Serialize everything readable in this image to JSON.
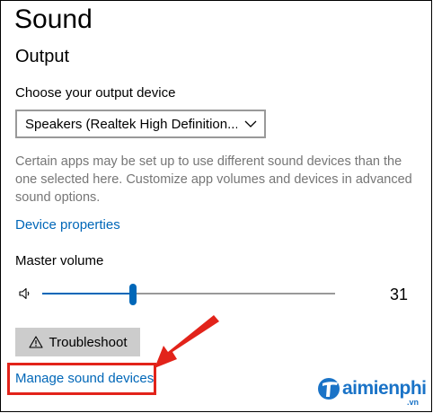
{
  "page": {
    "title": "Sound"
  },
  "output": {
    "section_title": "Output",
    "device_label": "Choose your output device",
    "device_selected": "Speakers (Realtek High Definition...",
    "description": "Certain apps may be set up to use different sound devices than the one selected here. Customize app volumes and devices in advanced sound options.",
    "device_properties_link": "Device properties",
    "master_volume_label": "Master volume",
    "volume_value": "31",
    "volume_level_percent": 31,
    "troubleshoot_label": "Troubleshoot",
    "manage_devices_link": "Manage sound devices"
  },
  "annotation": {
    "highlight_color": "#e2231a"
  },
  "watermark": {
    "text": "aimienphi",
    "suffix": ".vn"
  },
  "colors": {
    "accent": "#0067b8",
    "muted_text": "#767676",
    "button_bg": "#cccccc"
  },
  "icons": [
    "chevron-down-icon",
    "speaker-icon",
    "warning-icon",
    "arrow-icon"
  ]
}
